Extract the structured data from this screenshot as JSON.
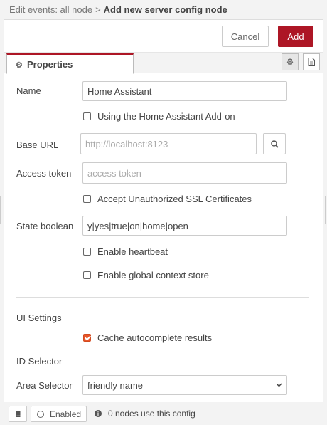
{
  "header": {
    "breadcrumb_parent": "Edit events: all node",
    "separator": ">",
    "title": "Add new server config node"
  },
  "toolbar": {
    "cancel_label": "Cancel",
    "add_label": "Add",
    "accent_color": "#ad1625"
  },
  "tabs": {
    "properties_label": "Properties"
  },
  "form": {
    "name": {
      "label": "Name",
      "value": "Home Assistant"
    },
    "addon_checkbox": {
      "label": "Using the Home Assistant Add-on",
      "checked": false
    },
    "base_url": {
      "label": "Base URL",
      "placeholder": "http://localhost:8123"
    },
    "access_token": {
      "label": "Access token",
      "placeholder": "access token"
    },
    "ssl_checkbox": {
      "label": "Accept Unauthorized SSL Certificates",
      "checked": false
    },
    "state_boolean": {
      "label": "State boolean",
      "value": "y|yes|true|on|home|open"
    },
    "heartbeat_checkbox": {
      "label": "Enable heartbeat",
      "checked": false
    },
    "global_context_checkbox": {
      "label": "Enable global context store",
      "checked": false
    },
    "ui_settings_heading": "UI Settings",
    "cache_checkbox": {
      "label": "Cache autocomplete results",
      "checked": true
    },
    "id_selector_label": "ID Selector",
    "area_selector": {
      "label": "Area Selector",
      "value": "friendly name"
    }
  },
  "footer": {
    "enabled_label": "Enabled",
    "usage_text": "0 nodes use this config"
  }
}
